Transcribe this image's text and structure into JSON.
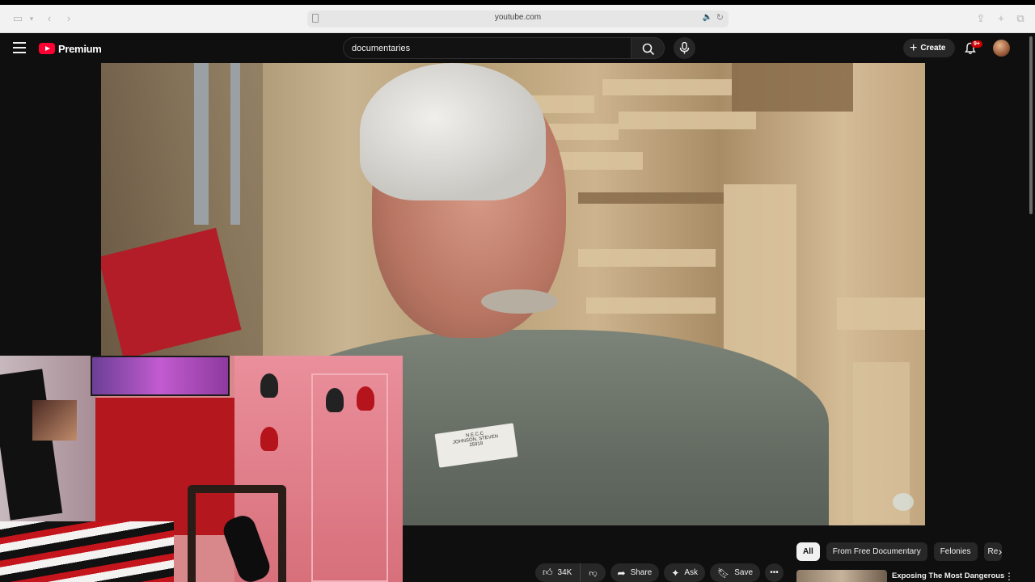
{
  "browser": {
    "url": "youtube.com"
  },
  "header": {
    "logo_label": "Premium",
    "search_value": "documentaries",
    "create_label": "Create",
    "notifications_badge": "9+"
  },
  "chips": [
    {
      "label": "All",
      "active": true
    },
    {
      "label": "From Free Documentary"
    },
    {
      "label": "Felonies"
    },
    {
      "label": "Re"
    }
  ],
  "actions": {
    "like_count": "34K",
    "share_label": "Share",
    "ask_label": "Ask",
    "save_label": "Save"
  },
  "recommendation": {
    "title": "Exposing The Most Dangerous"
  },
  "video": {
    "name_tag_line1": "N.E.C.C",
    "name_tag_line2": "JOHNSON, STEVEN",
    "name_tag_line3": "25919"
  },
  "colors": {
    "accent": "#ff0033",
    "background": "#0f0f0f",
    "chip_active": "#f1f1f1"
  }
}
